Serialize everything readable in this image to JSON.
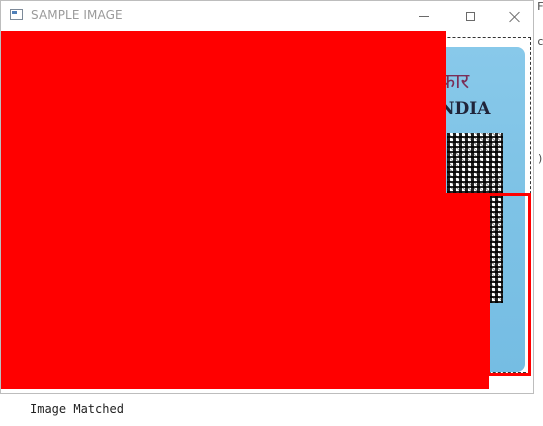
{
  "window": {
    "title": "SAMPLE IMAGE"
  },
  "card": {
    "script_text": "कार",
    "country_text": "NDIA"
  },
  "background": {
    "edge_glyphs": [
      "F",
      "c",
      ")"
    ]
  },
  "console": {
    "output": "Image Matched"
  },
  "colors": {
    "mask": "#ff0000",
    "card_blue": "#7fc3e6",
    "title_text": "#9a9a9a"
  },
  "icons": [
    "app-window-icon",
    "minimize-icon",
    "maximize-icon",
    "close-icon"
  ]
}
